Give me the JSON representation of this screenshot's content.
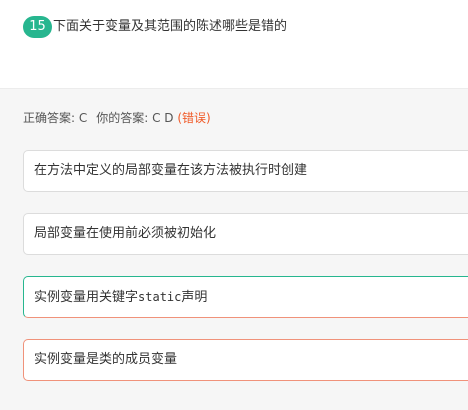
{
  "question": {
    "number": "15",
    "text": "下面关于变量及其范围的陈述哪些是错的"
  },
  "answer": {
    "correct_label": "正确答案: C",
    "yours_label": "你的答案: C D",
    "status": "(错误)"
  },
  "options": [
    {
      "text": "在方法中定义的局部变量在该方法被执行时创建"
    },
    {
      "text": "局部变量在使用前必须被初始化"
    },
    {
      "text_before": "实例变量用关键字",
      "code": "static",
      "text_after": "声明"
    },
    {
      "text": "实例变量是类的成员变量"
    }
  ],
  "colors": {
    "accent_green": "#27b68f",
    "error_orange": "#f05a28"
  }
}
